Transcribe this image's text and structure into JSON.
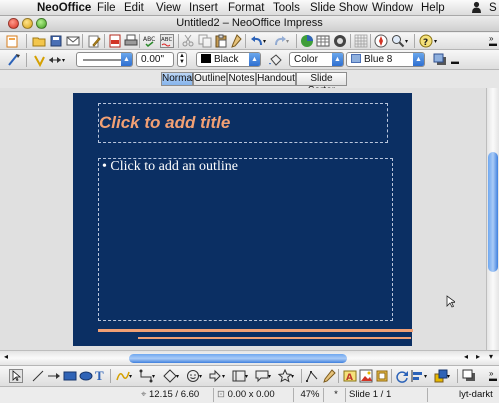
{
  "menubar": {
    "app_name": "NeoOffice",
    "items": [
      "File",
      "Edit",
      "View",
      "Insert",
      "Format",
      "Tools",
      "Slide Show",
      "Window",
      "Help"
    ],
    "right_label": "S"
  },
  "window": {
    "title": "Untitled2 – NeoOffice Impress"
  },
  "toolbar2": {
    "line_width_value": "0.00\"",
    "color_name": "Black",
    "area_style": "Color",
    "fill_color_name": "Blue 8"
  },
  "tabs": [
    "Normal",
    "Outline",
    "Notes",
    "Handout",
    "Slide Sorter"
  ],
  "active_tab": "Normal",
  "slide": {
    "title_placeholder": "Click to add title",
    "outline_bullet": "•",
    "outline_placeholder": "Click to add an outline",
    "background_color": "#0b2f63",
    "accent_color": "#f2a074"
  },
  "statusbar": {
    "position": "12.15 / 6.60",
    "size": "0.00 x 0.00",
    "zoom": "47%",
    "modified": "*",
    "slide_indicator": "Slide 1 / 1",
    "layout_name": "lyt-darkt"
  },
  "icons": {
    "toolbar1": [
      "new-document-icon",
      "open-folder-icon",
      "save-icon",
      "email-icon",
      "edit-file-icon",
      "export-pdf-icon",
      "print-icon",
      "spellcheck-icon",
      "autospellcheck-icon",
      "cut-icon",
      "copy-icon",
      "paste-icon",
      "clone-format-icon",
      "undo-icon",
      "redo-icon",
      "chart-icon",
      "table-icon",
      "display-grid-icon",
      "navigator-icon",
      "zoom-icon",
      "help-icon"
    ],
    "drawbar": [
      "select-arrow-icon",
      "line-icon",
      "arrow-line-icon",
      "rectangle-icon",
      "ellipse-icon",
      "text-icon",
      "curve-icon",
      "connector-icon",
      "basic-shapes-icon",
      "symbol-shapes-icon",
      "block-arrows-icon",
      "flowchart-icon",
      "callouts-icon",
      "stars-icon",
      "points-icon",
      "glue-points-icon",
      "fontwork-icon",
      "from-file-icon",
      "extrusion-icon",
      "rotate-icon",
      "align-icon",
      "arrange-icon",
      "shadow-icon"
    ]
  }
}
